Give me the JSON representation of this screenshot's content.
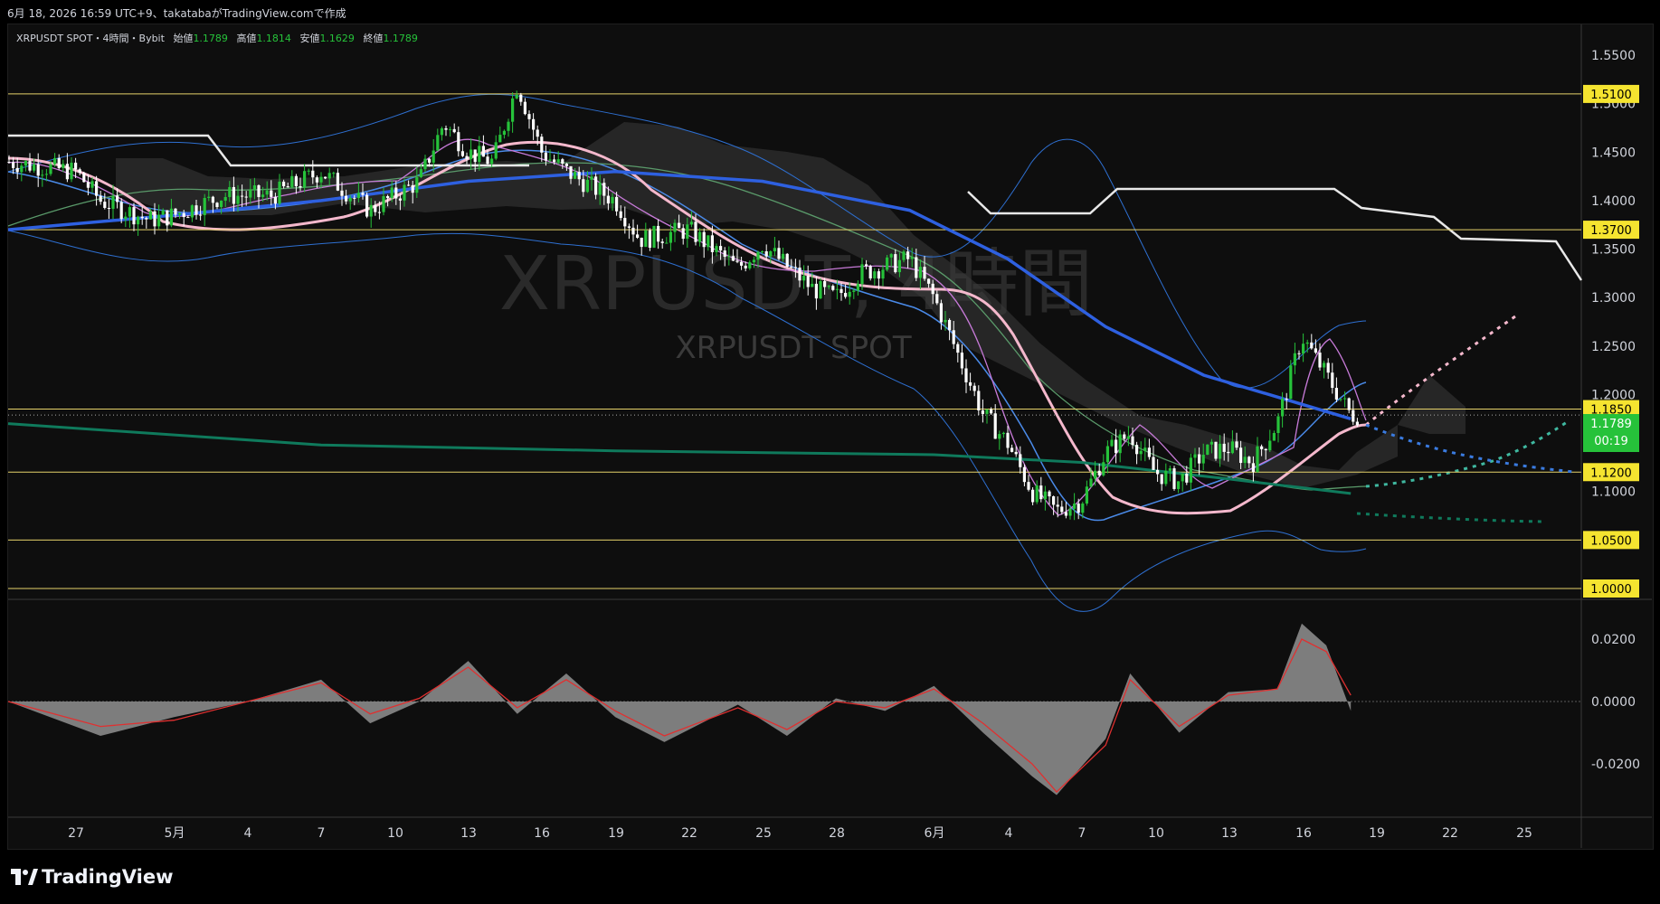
{
  "header": {
    "snapshot": "6月 18, 2026 16:59 UTC+9、takatabaがTradingView.comで作成"
  },
  "legend": {
    "symbol": "XRPUSDT SPOT・4時間・Bybit",
    "open_label": "始値",
    "open": "1.1789",
    "high_label": "高値",
    "high": "1.1814",
    "low_label": "安値",
    "low": "1.1629",
    "close_label": "終値",
    "close": "1.1789"
  },
  "watermark": {
    "line1": "XRPUSDT, 4時間",
    "line2": "XRPUSDT SPOT"
  },
  "price_axis": {
    "ticks": [
      "1.5500",
      "1.5000",
      "1.4500",
      "1.4000",
      "1.3500",
      "1.3000",
      "1.2500",
      "1.2000",
      "1.1500",
      "1.1000",
      "1.0500",
      "1.0000"
    ]
  },
  "horizontal_levels": [
    {
      "label": "1.5100",
      "value": 1.51
    },
    {
      "label": "1.3700",
      "value": 1.37
    },
    {
      "label": "1.1850",
      "value": 1.185
    },
    {
      "label": "1.1200",
      "value": 1.12
    },
    {
      "label": "1.0500",
      "value": 1.05
    },
    {
      "label": "1.0000",
      "value": 1.0
    }
  ],
  "current_price": {
    "label": "1.1789",
    "countdown": "00:19",
    "color": "#26c23a"
  },
  "osc_axis": {
    "ticks": [
      "0.0200",
      "0.0000",
      "-0.0200"
    ]
  },
  "time_axis": {
    "labels": [
      "27",
      "5月",
      "4",
      "7",
      "10",
      "13",
      "16",
      "19",
      "22",
      "25",
      "28",
      "6月",
      "4",
      "7",
      "10",
      "13",
      "16",
      "19",
      "22",
      "25"
    ]
  },
  "brand": "TradingView",
  "chart_data": [
    {
      "type": "line",
      "title": "XRPUSDT SPOT・4時間・Bybit",
      "ylim": [
        0.975,
        1.575
      ],
      "x_range": [
        "4/27",
        "6/25"
      ],
      "series": [
        {
          "name": "close",
          "color": "#ffffff",
          "x": [
            "4/24",
            "4/27",
            "4/28",
            "4/30",
            "5/1",
            "5/3",
            "5/5",
            "5/7",
            "5/9",
            "5/11",
            "5/12",
            "5/13",
            "5/14",
            "5/15",
            "5/16",
            "5/17",
            "5/19",
            "5/20",
            "5/22",
            "5/24",
            "5/25",
            "5/27",
            "5/28",
            "5/29",
            "5/31",
            "6/1",
            "6/2",
            "6/3",
            "6/4",
            "6/5",
            "6/6",
            "6/7",
            "6/8",
            "6/9",
            "6/10",
            "6/11",
            "6/12",
            "6/13",
            "6/14",
            "6/15",
            "6/16",
            "6/17",
            "6/18"
          ],
          "values": [
            1.44,
            1.43,
            1.4,
            1.38,
            1.385,
            1.405,
            1.405,
            1.43,
            1.39,
            1.42,
            1.48,
            1.45,
            1.44,
            1.52,
            1.45,
            1.43,
            1.4,
            1.36,
            1.37,
            1.33,
            1.355,
            1.31,
            1.3,
            1.325,
            1.34,
            1.3,
            1.24,
            1.18,
            1.15,
            1.1,
            1.08,
            1.09,
            1.14,
            1.16,
            1.12,
            1.11,
            1.14,
            1.145,
            1.13,
            1.17,
            1.26,
            1.22,
            1.179
          ]
        },
        {
          "name": "slow MA",
          "color": "#2e60e0",
          "x": [
            "4/24",
            "5/1",
            "5/7",
            "5/13",
            "5/19",
            "5/25",
            "5/31",
            "6/4",
            "6/8",
            "6/12",
            "6/16",
            "6/18"
          ],
          "values": [
            1.37,
            1.385,
            1.4,
            1.42,
            1.43,
            1.42,
            1.39,
            1.34,
            1.27,
            1.22,
            1.19,
            1.175
          ]
        },
        {
          "name": "long MA",
          "color": "#0f7a5c",
          "x": [
            "4/24",
            "5/7",
            "5/19",
            "6/1",
            "6/7",
            "6/13",
            "6/18"
          ],
          "values": [
            1.17,
            1.148,
            1.142,
            1.138,
            1.13,
            1.113,
            1.098
          ]
        }
      ]
    },
    {
      "type": "area",
      "ylim": [
        -0.03,
        0.03
      ],
      "series": [
        {
          "name": "histogram",
          "color": "#8a8a8a",
          "x": [
            "4/24",
            "4/28",
            "5/1",
            "5/4",
            "5/7",
            "5/9",
            "5/11",
            "5/13",
            "5/15",
            "5/17",
            "5/19",
            "5/21",
            "5/24",
            "5/26",
            "5/28",
            "5/30",
            "6/1",
            "6/3",
            "6/5",
            "6/6",
            "6/8",
            "6/9",
            "6/11",
            "6/13",
            "6/15",
            "6/16",
            "6/17",
            "6/18"
          ],
          "values": [
            0.0,
            -0.011,
            -0.005,
            0.0,
            0.007,
            -0.007,
            0.0,
            0.013,
            -0.004,
            0.009,
            -0.005,
            -0.013,
            -0.001,
            -0.011,
            0.001,
            -0.003,
            0.005,
            -0.01,
            -0.024,
            -0.03,
            -0.012,
            0.009,
            -0.01,
            0.003,
            0.004,
            0.025,
            0.018,
            -0.003
          ]
        },
        {
          "name": "signal",
          "color": "#e03030",
          "x": [
            "4/24",
            "4/28",
            "5/1",
            "5/4",
            "5/7",
            "5/9",
            "5/11",
            "5/13",
            "5/15",
            "5/17",
            "5/19",
            "5/21",
            "5/24",
            "5/26",
            "5/28",
            "5/30",
            "6/1",
            "6/3",
            "6/5",
            "6/6",
            "6/8",
            "6/9",
            "6/11",
            "6/13",
            "6/15",
            "6/16",
            "6/17",
            "6/18"
          ],
          "values": [
            0.0,
            -0.008,
            -0.006,
            0.0,
            0.006,
            -0.004,
            0.001,
            0.011,
            -0.002,
            0.007,
            -0.003,
            -0.011,
            -0.002,
            -0.009,
            0.0,
            -0.002,
            0.004,
            -0.007,
            -0.02,
            -0.029,
            -0.014,
            0.007,
            -0.008,
            0.002,
            0.004,
            0.02,
            0.016,
            0.002
          ]
        }
      ]
    }
  ]
}
